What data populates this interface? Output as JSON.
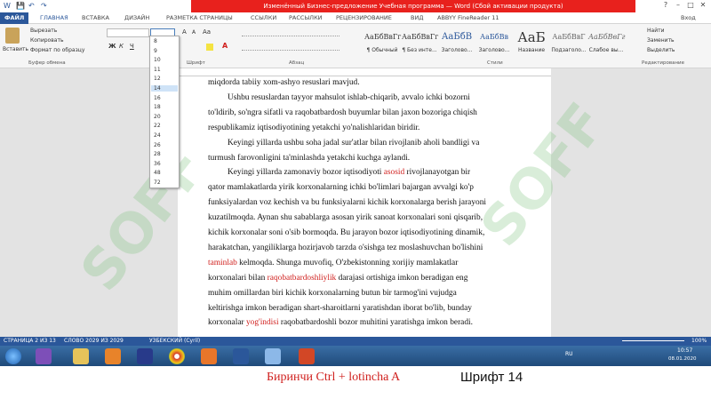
{
  "window": {
    "title": "Изменённый Бизнес-предложение Учебная программа — Word (Сбой активации продукта)",
    "user": "Вход"
  },
  "qat": {
    "save_glyph": "💾",
    "undo_glyph": "↶",
    "redo_glyph": "↷"
  },
  "tabs": [
    "ФАЙЛ",
    "ГЛАВНАЯ",
    "ВСТАВКА",
    "ДИЗАЙН",
    "РАЗМЕТКА СТРАНИЦЫ",
    "ССЫЛКИ",
    "РАССЫЛКИ",
    "РЕЦЕНЗИРОВАНИЕ",
    "ВИД",
    "ABBYY FineReader 11"
  ],
  "ribbon": {
    "paste_label": "Вставить",
    "cut_label": "Вырезать",
    "copy_label": "Копировать",
    "format_painter_label": "Формат по образцу",
    "clipboard_group": "Буфер обмена",
    "font_group": "Шрифт",
    "paragraph_group": "Абзац",
    "styles_group": "Стили",
    "editing_group": "Редактирование",
    "find_label": "Найти",
    "replace_label": "Заменить",
    "select_label": "Выделить",
    "bold": "Ж",
    "italic": "К",
    "underline": "Ч",
    "styles": [
      {
        "preview": "АаБбВвГг",
        "name": "¶ Обычный"
      },
      {
        "preview": "АаБбВвГг",
        "name": "¶ Без инте..."
      },
      {
        "preview": "АаБбВ",
        "name": "Заголово..."
      },
      {
        "preview": "АаБбВв",
        "name": "Заголово..."
      },
      {
        "preview": "АаБ",
        "name": "Название"
      },
      {
        "preview": "АаБбВвГ",
        "name": "Подзаголо..."
      },
      {
        "preview": "АаБбВвГг",
        "name": "Слабое вы..."
      }
    ]
  },
  "font_size_dropdown": [
    "8",
    "9",
    "10",
    "11",
    "12",
    "14",
    "16",
    "18",
    "20",
    "22",
    "24",
    "26",
    "28",
    "36",
    "48",
    "72"
  ],
  "font_size_selected_index": 5,
  "document_lines": [
    {
      "segments": [
        {
          "t": "miqdorda tabiiy xom-ashyo resuslari mavjud."
        }
      ],
      "indent": false
    },
    {
      "segments": [
        {
          "t": "Ushbu resuslardan tayyor mahsulot ishlab-chiqarib, avvalo ichki bozorni"
        }
      ],
      "indent": true
    },
    {
      "segments": [
        {
          "t": "to'ldirib, so'ngra sifatli va raqobatbardosh buyumlar bilan jaxon bozoriga chiqish"
        }
      ],
      "indent": false
    },
    {
      "segments": [
        {
          "t": "respublikamiz iqtisodiyotining yetakchi yo'nalishlaridan biridir."
        }
      ],
      "indent": false
    },
    {
      "segments": [
        {
          "t": "Keyingi yillarda ushbu soha jadal sur'atlar bilan rivojlanib aholi bandligi va"
        }
      ],
      "indent": true
    },
    {
      "segments": [
        {
          "t": "turmush farovonligini ta'minlashda yetakchi kuchga aylandi."
        }
      ],
      "indent": false
    },
    {
      "segments": [
        {
          "t": "Keyingi yillarda zamonaviy bozor iqtisodiyoti "
        },
        {
          "t": "asosid",
          "r": true
        },
        {
          "t": " rivojlanayotgan bir"
        }
      ],
      "indent": true
    },
    {
      "segments": [
        {
          "t": "qator mamlakatlarda yirik korxonalarning ichki bo'limlari bajargan avvalgi ko'p"
        }
      ],
      "indent": false
    },
    {
      "segments": [
        {
          "t": "funksiyalardan voz kechish va bu funksiyalarni kichik korxonalarga berish jarayoni"
        }
      ],
      "indent": false
    },
    {
      "segments": [
        {
          "t": "kuzatilmoqda. Aynan shu sabablarga asosan yirik sanoat korxonalari soni qisqarib,"
        }
      ],
      "indent": false
    },
    {
      "segments": [
        {
          "t": "kichik korxonalar soni o'sib bormoqda. Bu jarayon bozor iqtisodiyotining dinamik,"
        }
      ],
      "indent": false
    },
    {
      "segments": [
        {
          "t": "harakatchan, yangiliklarga hozirjavob tarzda o'sishga tez moslashuvchan bo'lishini"
        }
      ],
      "indent": false
    },
    {
      "segments": [
        {
          "t": "taminlab",
          "r": true
        },
        {
          "t": " kelmoqda. Shunga muvofiq, O'zbekistonning xorijiy mamlakatlar"
        }
      ],
      "indent": false
    },
    {
      "segments": [
        {
          "t": "korxonalari bilan "
        },
        {
          "t": "raqobatbardoshliylik",
          "r": true
        },
        {
          "t": " darajasi ortishiga imkon beradigan eng"
        }
      ],
      "indent": false
    },
    {
      "segments": [
        {
          "t": "muhim omillardan biri kichik korxonalarning butun bir tarmog'ini vujudga"
        }
      ],
      "indent": false
    },
    {
      "segments": [
        {
          "t": "keltirishga imkon beradigan shart-sharoitlarni yaratishdan iborat bo'lib, bunday"
        }
      ],
      "indent": false
    },
    {
      "segments": [
        {
          "t": "korxonalar "
        },
        {
          "t": "yog'indisi",
          "r": true
        },
        {
          "t": " raqobatbardoshli bozor muhitini yaratishga imkon beradi."
        }
      ],
      "indent": false
    }
  ],
  "statusbar": {
    "page": "СТРАНИЦА 2 ИЗ 13",
    "words": "СЛОВО 2029 ИЗ 2029",
    "lang": "УЗБЕКСКИЙ (Cyril)",
    "zoom": "100%"
  },
  "taskbar": {
    "lang": "RU",
    "time": "10:57",
    "date": "08.01.2020"
  },
  "caption": {
    "left": "Биринчи Ctrl + lotincha A",
    "right": "Шрифт 14"
  },
  "watermark": "SOFF",
  "colors": {
    "accent": "#2b579a",
    "alert": "#e8211d",
    "error_text": "#d0201e"
  }
}
